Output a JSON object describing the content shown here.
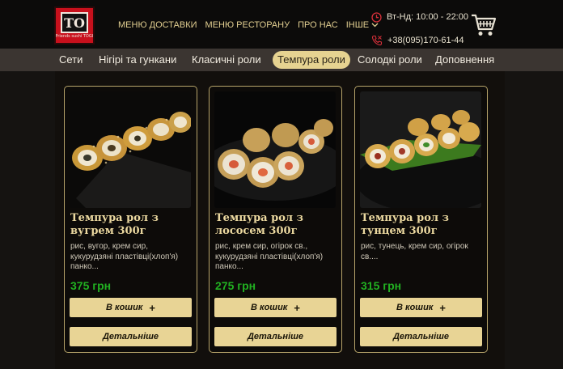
{
  "header": {
    "logo_mark": "TO",
    "logo_tagline": "Friends sushi TOGI",
    "nav": [
      "МЕНЮ ДОСТАВКИ",
      "МЕНЮ РЕСТОРАНУ",
      "ПРО НАС",
      "ІНШЕ"
    ],
    "hours": "Вт-Нд: 10:00 - 22:00",
    "phone": "+38(095)170-61-44"
  },
  "categories": {
    "items": [
      "Сети",
      "Нігірі та гункани",
      "Класичні роли",
      "Темпура роли",
      "Солодкі роли",
      "Доповнення"
    ],
    "active_index": 3
  },
  "products": [
    {
      "title": "Темпура рол з вугрем 300г",
      "description": "рис, вугор, крем сир, кукурудзяні пластівці(хлоп'я) панко...",
      "price": "375 грн",
      "add_label": "В кошик",
      "details_label": "Детальніше"
    },
    {
      "title": "Темпура рол з лососем 300г",
      "description": "рис, крем сир, огірок св., кукурудзяні пластівці(хлоп'я) панко...",
      "price": "275 грн",
      "add_label": "В кошик",
      "details_label": "Детальніше"
    },
    {
      "title": "Темпура рол з тунцем 300г",
      "description": "рис, тунець, крем сир, огірок св....",
      "price": "315 грн",
      "add_label": "В кошик",
      "details_label": "Детальніше"
    }
  ],
  "colors": {
    "accent_gold": "#e8d495",
    "price_green": "#21b021",
    "logo_red": "#c8101c",
    "icon_red": "#d6303a"
  },
  "icons": [
    "clock-icon",
    "phone-icon",
    "cart-icon",
    "chevron-down-icon",
    "plus-icon"
  ]
}
